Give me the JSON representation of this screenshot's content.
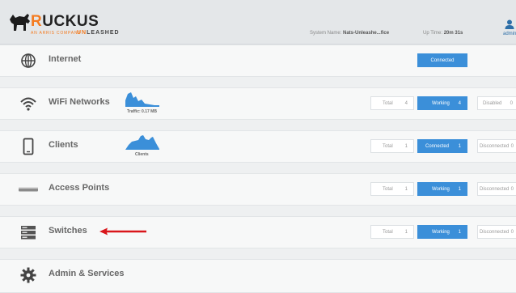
{
  "header": {
    "brand": "RUCKUS",
    "tagline": "an ARRIS company",
    "product_un": "UN",
    "product_rest": "LEASHED",
    "system_name_label": "System Name:",
    "system_name_value": "Nats-Unleashe...fice",
    "uptime_label": "Up Time:",
    "uptime_value": "20m 31s",
    "user": "admin"
  },
  "rows": {
    "internet": {
      "title": "Internet",
      "status": "Connected"
    },
    "wifi": {
      "title": "WiFi Networks",
      "spark_label": "Traffic: 0.17 MB",
      "total_label": "Total",
      "total_value": "4",
      "working_label": "Working",
      "working_value": "4",
      "disabled_label": "Disabled",
      "disabled_value": "0"
    },
    "clients": {
      "title": "Clients",
      "spark_label": "Clients",
      "total_label": "Total",
      "total_value": "1",
      "connected_label": "Connected",
      "connected_value": "1",
      "disconnected_label": "Disconnected",
      "disconnected_value": "0"
    },
    "aps": {
      "title": "Access Points",
      "total_label": "Total",
      "total_value": "1",
      "working_label": "Working",
      "working_value": "1",
      "disconnected_label": "Disconnected",
      "disconnected_value": "0"
    },
    "switches": {
      "title": "Switches",
      "total_label": "Total",
      "total_value": "1",
      "working_label": "Working",
      "working_value": "1",
      "disconnected_label": "Disconnected",
      "disconnected_value": "0"
    },
    "admin": {
      "title": "Admin & Services"
    }
  },
  "colors": {
    "accent_blue": "#3b8fd9",
    "brand_orange": "#f47b20",
    "arrow_red": "#d9161b"
  },
  "icons": {
    "internet": "globe-icon",
    "wifi": "wifi-icon",
    "clients": "phone-icon",
    "aps": "access-point-icon",
    "switches": "switch-stack-icon",
    "admin": "gear-icon",
    "user": "user-icon"
  }
}
